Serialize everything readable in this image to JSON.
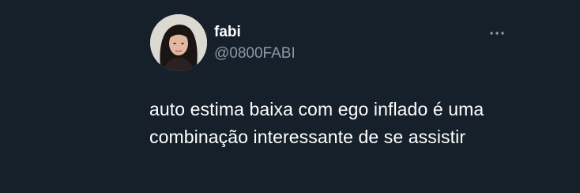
{
  "tweet": {
    "author": {
      "display_name": "fabi",
      "handle": "@0800FABI"
    },
    "text": "auto estima baixa com ego inflado é uma combinação interessante de se assistir",
    "more_icon": "more-horizontal-icon"
  },
  "colors": {
    "background": "#15202b",
    "primary_text": "#ffffff",
    "secondary_text": "#8b98a5"
  }
}
